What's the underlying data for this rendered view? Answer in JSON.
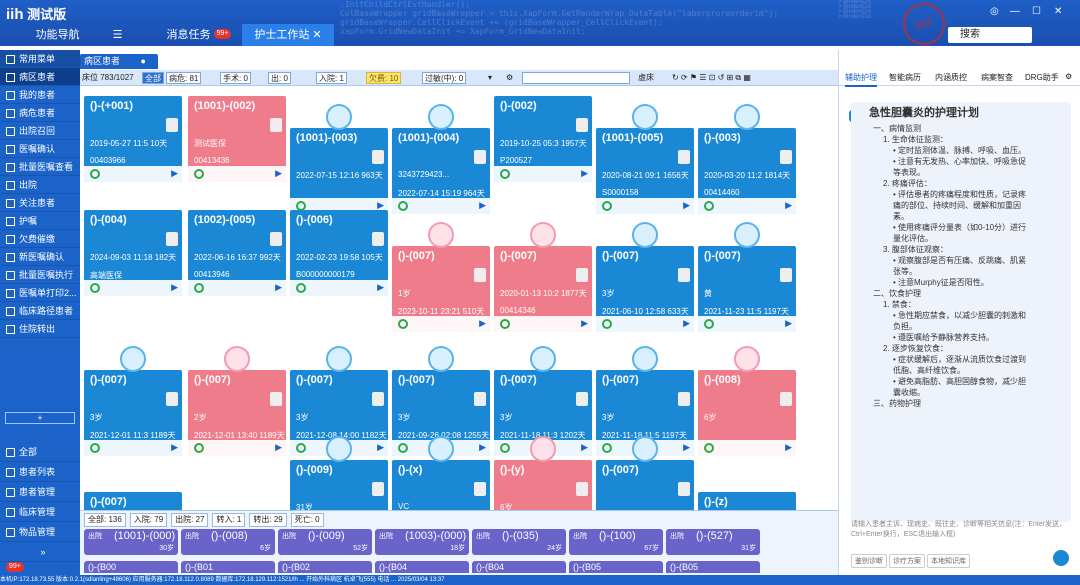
{
  "app": {
    "logo_mark": "iih",
    "title": "测试版",
    "stamp": "测试"
  },
  "nav": {
    "tabs": [
      {
        "label": "功能导航"
      },
      {
        "label": "消息任务",
        "badge": "99+"
      },
      {
        "label": "护士工作站"
      }
    ]
  },
  "search": {
    "label": "搜索"
  },
  "sidebar": {
    "header": "常用菜单",
    "items": [
      "病区患者",
      "我的患者",
      "病危患者",
      "出院召回",
      "医嘱确认",
      "批量医嘱查看",
      "出院",
      "关注患者",
      "护嘱",
      "欠费催缴",
      "新医嘱确认",
      "批量医嘱执行",
      "医嘱单打印2...",
      "临床路径患者",
      "住院转出"
    ],
    "bottom": [
      "全部",
      "患者列表",
      "患者管理",
      "临床管理",
      "物品管理"
    ],
    "badge": "99+"
  },
  "main_tab": "病区患者",
  "toolbar": {
    "beds": "床位 783/1027",
    "all": "全部",
    "critical": "病危: 81",
    "surgery": "手术: 0",
    "other": "出: 0",
    "admit": "入院: 1",
    "arrears": "欠费: 10",
    "overdue": "过敏(中): 0",
    "inhosp": "虚床"
  },
  "cards": [
    {
      "title": "()-(+001)",
      "l1": "2019-05-27 11:5 10天",
      "l2": "00403966",
      "color": "blue"
    },
    {
      "title": "(1001)-(002)",
      "l1": "测试医保",
      "l2": "00413436",
      "color": "pink"
    },
    {
      "title": "(1001)-(003)",
      "l1": "2022-07-15 12:16 963天",
      "l2": "",
      "color": "blue"
    },
    {
      "title": "(1001)-(004)",
      "l1": "3243729423...",
      "l2": "2022-07-14 15:19 964天",
      "color": "blue"
    },
    {
      "title": "()-(002)",
      "l1": "2019-10-25 05:3 1957天",
      "l2": "P200527",
      "color": "blue"
    },
    {
      "title": "(1001)-(005)",
      "l1": "2020-08-21 09:1 1656天",
      "l2": "S0000158",
      "color": "blue"
    },
    {
      "title": "()-(003)",
      "l1": "2020-03-20 11:2 1814天",
      "l2": "00414460",
      "color": "blue"
    },
    {
      "title": "()-(004)",
      "l1": "2024-09-03 11:18 182天",
      "l2": "高端医保",
      "color": "blue"
    },
    {
      "title": "(1002)-(005)",
      "l1": "2022-06-16 16:37 992天",
      "l2": "00413946",
      "color": "blue"
    },
    {
      "title": "()-(006)",
      "l1": "2022-02-23 19:58 105天",
      "l2": "B000000000179",
      "color": "blue"
    },
    {
      "title": "()-(007)",
      "l1": "1岁",
      "l2": "2023-10-11 23:21 510天",
      "color": "pink"
    },
    {
      "title": "()-(007)",
      "l1": "2020-01-13 10:2 1877天",
      "l2": "00414346",
      "color": "pink"
    },
    {
      "title": "()-(007)",
      "l1": "3岁",
      "l2": "2021-06-10 12:58 633天",
      "color": "blue"
    },
    {
      "title": "()-(007)",
      "l1": "黄",
      "l2": "2021-11-23 11:5 1197天",
      "color": "blue"
    },
    {
      "title": "()-(007)",
      "l1": "3岁",
      "l2": "2021-12-01 11:3 1189天",
      "color": "blue"
    },
    {
      "title": "()-(007)",
      "l1": "2岁",
      "l2": "2021-12-01 13:40 1189天",
      "color": "pink"
    },
    {
      "title": "()-(007)",
      "l1": "3岁",
      "l2": "2021-12-08 14:00 1182天",
      "color": "blue"
    },
    {
      "title": "()-(007)",
      "l1": "3岁",
      "l2": "2021-09-26 02:08 1255天",
      "color": "blue"
    },
    {
      "title": "()-(007)",
      "l1": "3岁",
      "l2": "2021-11-18 11:3 1202天",
      "color": "blue"
    },
    {
      "title": "()-(007)",
      "l1": "3岁",
      "l2": "2021-11-18 11:5 1197天",
      "color": "blue"
    },
    {
      "title": "()-(008)",
      "l1": "6岁",
      "l2": "",
      "color": "pink"
    },
    {
      "title": "()-(009)",
      "l1": "31岁",
      "l2": "",
      "color": "blue"
    },
    {
      "title": "()-(x)",
      "l1": "VC",
      "l2": "31岁",
      "color": "blue"
    },
    {
      "title": "()-(y)",
      "l1": "6岁",
      "l2": "",
      "color": "pink"
    },
    {
      "title": "()-(007)",
      "l1": "",
      "l2": "",
      "color": "blue"
    },
    {
      "title": "()-(007)",
      "l1": "",
      "l2": "",
      "color": "blue"
    },
    {
      "title": "()-(z)",
      "l1": "",
      "l2": "",
      "color": "blue"
    }
  ],
  "counts": {
    "all": "全部: 136",
    "admit": "入院: 79",
    "out": "出院: 27",
    "transfer": "转入: 1",
    "transferout": "转出: 29",
    "death": "死亡: 0"
  },
  "beds": [
    {
      "a": "出院",
      "b": "(1001)-(000)",
      "c": "30岁"
    },
    {
      "a": "出院",
      "b": "()-(008)",
      "c": "6岁"
    },
    {
      "a": "出院",
      "b": "()-(009)",
      "c": "52岁"
    },
    {
      "a": "出院",
      "b": "(1003)-(000)",
      "c": "18岁"
    },
    {
      "a": "出院",
      "b": "()-(035)",
      "c": "24岁"
    },
    {
      "a": "出院",
      "b": "()-(100)",
      "c": "67岁"
    },
    {
      "a": "出院",
      "b": "()-(527)",
      "c": "31岁"
    }
  ],
  "beds2": [
    "()-(B00",
    "()-(B01",
    "()-(B02",
    "()-(B04",
    "()-(B04",
    "()-(B05",
    "()-(B05"
  ],
  "right": {
    "tabs": [
      "辅助护理",
      "智能病历",
      "内涵质控",
      "病案智查",
      "DRG助手"
    ],
    "title": "急性胆囊炎的护理计划",
    "lines": [
      "一、病情监测",
      "1. 生命体征监测：",
      "• 定时监测体温、脉搏、呼吸、血压。",
      "• 注意有无发热、心率加快、呼吸急促",
      "  等表现。",
      "2. 疼痛评估：",
      "• 评估患者的疼痛程度和性质，记录疼",
      "  痛的部位、持续时间、缓解和加重因",
      "  素。",
      "• 使用疼痛评分量表（如0-10分）进行",
      "  量化评估。",
      "3. 腹部体征观察：",
      "• 观察腹部是否有压痛、反跳痛、肌紧",
      "  张等。",
      "• 注意Murphy征是否阳性。",
      "二、饮食护理",
      "1. 禁食：",
      "• 急性期应禁食，以减少胆囊的刺激和",
      "  负担。",
      "• 遵医嘱给予静脉营养支持。",
      "2. 逐步恢复饮食：",
      "• 症状缓解后，逐渐从流质饮食过渡到",
      "  低脂、高纤维饮食。",
      "• 避免高脂肪、高胆固醇食物，减少胆",
      "  囊收缩。",
      "三、药物护理"
    ],
    "input_hint": "请输入患者主诉、现病史、既往史、诊断等相关信息(注：Enter发送，Ctrl+Enter换行，ESC退出输入框)",
    "buttons": [
      "鉴别诊断",
      "诊疗方案",
      "本地知识库"
    ]
  },
  "statusbar": "本机IP:172.18.73.55 版本:0.2.1(sdlanling+48606) 应用服务器:172.18.112.0.8089 数据库:172.18.129.112:1521/lh ... 开始外科病区 杭卓飞(555) 电话 ... 2025/03/04 13:37"
}
